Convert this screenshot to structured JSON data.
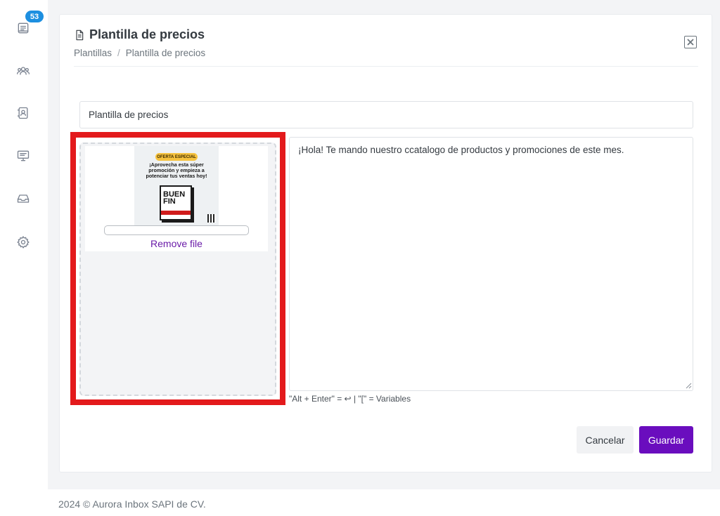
{
  "sidebar": {
    "badge_count": "53",
    "items": [
      {
        "icon": "inbox-icon"
      },
      {
        "icon": "users-icon"
      },
      {
        "icon": "contacts-icon"
      },
      {
        "icon": "monitor-icon"
      },
      {
        "icon": "tray-icon"
      },
      {
        "icon": "gear-icon"
      }
    ]
  },
  "header": {
    "title": "Plantilla de precios",
    "breadcrumb": [
      "Plantillas",
      "Plantilla de precios"
    ],
    "breadcrumb_separator": "/"
  },
  "form": {
    "name_value": "Plantilla de precios",
    "message_value": "¡Hola! Te mando nuestro ccatalogo de productos y promociones de este mes.",
    "hint": "\"Alt + Enter\" = ↩ |   \"[\" = Variables",
    "dropzone": {
      "remove_label": "Remove file",
      "thumbnail": {
        "tag": "OFERTA ESPECIAL",
        "headline": "¡Aprovecha esta súper promoción y empieza a potenciar tus ventas hoy!",
        "box_text": "BUEN FIN"
      }
    },
    "cancel_label": "Cancelar",
    "save_label": "Guardar"
  },
  "colors": {
    "accent": "#6a0dbe",
    "badge": "#1d8fe0",
    "highlight": "#e31a1c"
  },
  "footer": {
    "text": "2024 © Aurora Inbox SAPI de CV."
  }
}
